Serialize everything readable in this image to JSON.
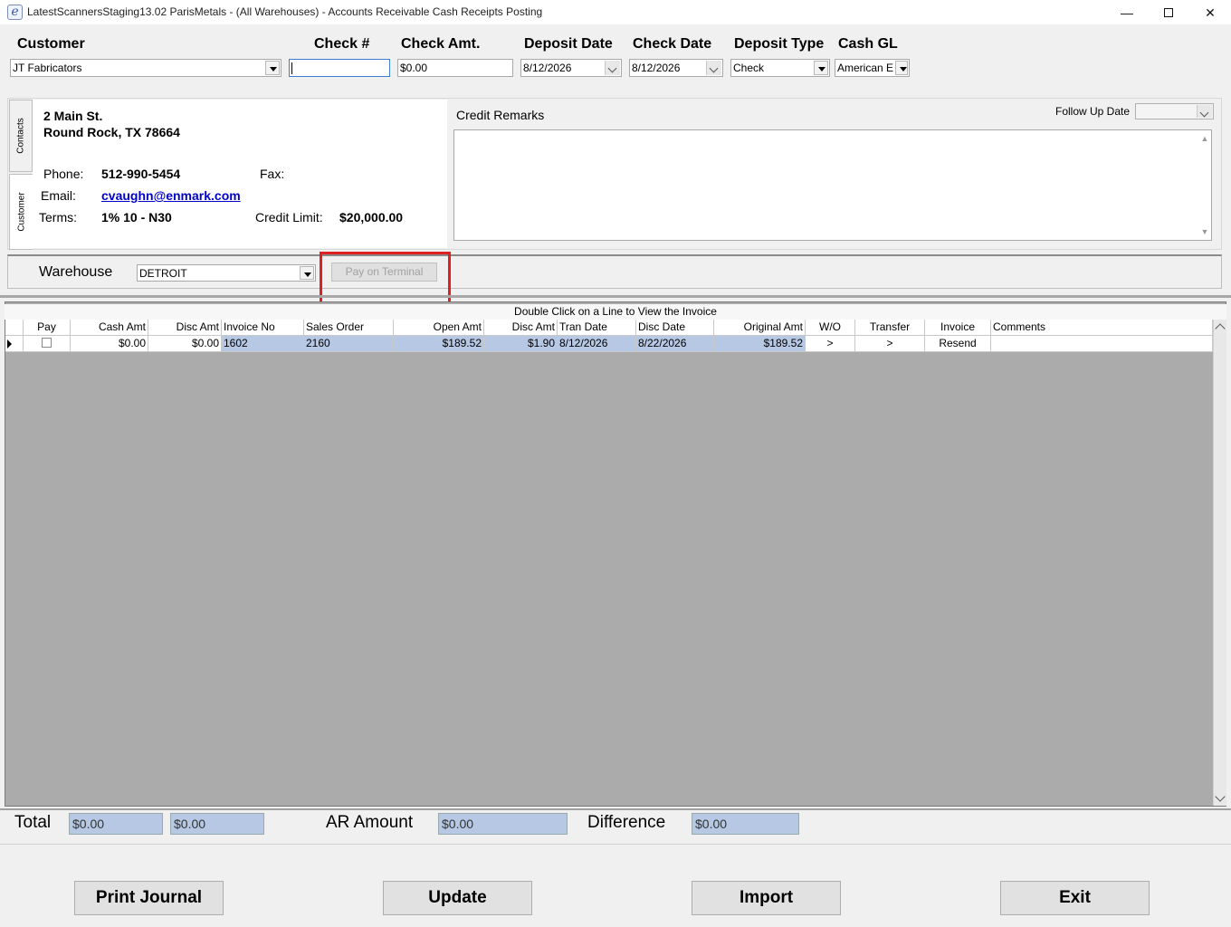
{
  "window": {
    "title": "LatestScannersStaging13.02 ParisMetals - (All Warehouses) - Accounts Receivable Cash Receipts Posting",
    "icon_letter": "e"
  },
  "header": {
    "customer_label": "Customer",
    "customer_value": "JT Fabricators",
    "check_no_label": "Check #",
    "check_no_value": "",
    "check_amt_label": "Check Amt.",
    "check_amt_value": "$0.00",
    "deposit_date_label": "Deposit Date",
    "deposit_date_value": "8/12/2026",
    "check_date_label": "Check Date",
    "check_date_value": "8/12/2026",
    "deposit_type_label": "Deposit Type",
    "deposit_type_value": "Check",
    "cash_gl_label": "Cash GL",
    "cash_gl_value": "American E"
  },
  "tabs": {
    "contacts": "Contacts",
    "customer": "Customer"
  },
  "customer_info": {
    "address_line1": "2 Main St.",
    "address_line2": "Round Rock, TX  78664",
    "phone_label": "Phone:",
    "phone_value": "512-990-5454",
    "fax_label": "Fax:",
    "fax_value": "",
    "email_label": "Email:",
    "email_value": "cvaughn@enmark.com",
    "terms_label": "Terms:",
    "terms_value": "1% 10 - N30",
    "credit_limit_label": "Credit Limit:",
    "credit_limit_value": "$20,000.00"
  },
  "credit": {
    "remarks_label": "Credit Remarks",
    "follow_up_label": "Follow Up Date",
    "follow_up_value": ""
  },
  "warehouse": {
    "label": "Warehouse",
    "value": "DETROIT",
    "pay_terminal_label": "Pay on Terminal"
  },
  "grid": {
    "caption": "Double Click on a Line to View the Invoice",
    "columns": [
      "Pay",
      "Cash Amt",
      "Disc Amt",
      "Invoice No",
      "Sales Order",
      "Open Amt",
      "Disc Amt",
      "Tran Date",
      "Disc Date",
      "Original Amt",
      "W/O",
      "Transfer",
      "Invoice",
      "Comments"
    ],
    "rows": [
      {
        "pay": false,
        "cash_amt": "$0.00",
        "disc_amt": "$0.00",
        "invoice_no": "1602",
        "sales_order": "2160",
        "open_amt": "$189.52",
        "disc_amt2": "$1.90",
        "tran_date": "8/12/2026",
        "disc_date": "8/22/2026",
        "original_amt": "$189.52",
        "wo": ">",
        "transfer": ">",
        "invoice": "Resend",
        "comments": ""
      }
    ]
  },
  "totals": {
    "total_label": "Total",
    "total_cash": "$0.00",
    "total_disc": "$0.00",
    "ar_amount_label": "AR Amount",
    "ar_amount_value": "$0.00",
    "difference_label": "Difference",
    "difference_value": "$0.00"
  },
  "buttons": {
    "print_journal": "Print Journal",
    "update": "Update",
    "import": "Import",
    "exit": "Exit"
  },
  "colors": {
    "selection": "#b7c8e4",
    "highlight_box": "#e02020",
    "link": "#0000cc"
  }
}
